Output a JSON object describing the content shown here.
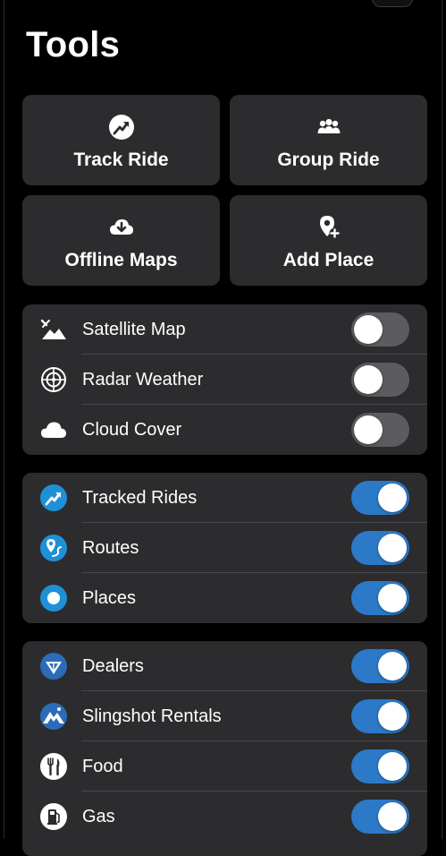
{
  "header": {
    "title": "Tools"
  },
  "tiles": [
    {
      "label": "Track Ride",
      "icon": "track-ride-icon"
    },
    {
      "label": "Group Ride",
      "icon": "group-ride-icon"
    },
    {
      "label": "Offline Maps",
      "icon": "download-cloud-icon"
    },
    {
      "label": "Add Place",
      "icon": "add-place-icon"
    }
  ],
  "map_layers": [
    {
      "label": "Satellite Map",
      "icon": "satellite-map-icon",
      "enabled": false
    },
    {
      "label": "Radar Weather",
      "icon": "radar-icon",
      "enabled": false
    },
    {
      "label": "Cloud Cover",
      "icon": "cloud-icon",
      "enabled": false
    }
  ],
  "my_content": [
    {
      "label": "Tracked Rides",
      "icon": "tracked-rides-icon",
      "enabled": true
    },
    {
      "label": "Routes",
      "icon": "routes-icon",
      "enabled": true
    },
    {
      "label": "Places",
      "icon": "places-icon",
      "enabled": true
    }
  ],
  "points_of_interest": [
    {
      "label": "Dealers",
      "icon": "dealers-icon",
      "enabled": true
    },
    {
      "label": "Slingshot Rentals",
      "icon": "rentals-icon",
      "enabled": true
    },
    {
      "label": "Food",
      "icon": "food-icon",
      "enabled": true
    },
    {
      "label": "Gas",
      "icon": "gas-icon",
      "enabled": true
    }
  ],
  "colors": {
    "background": "#000000",
    "card": "#2c2c2e",
    "toggle_on": "#2b79c7",
    "toggle_off": "#5c5c60",
    "accent_blue": "#1e90d6"
  }
}
